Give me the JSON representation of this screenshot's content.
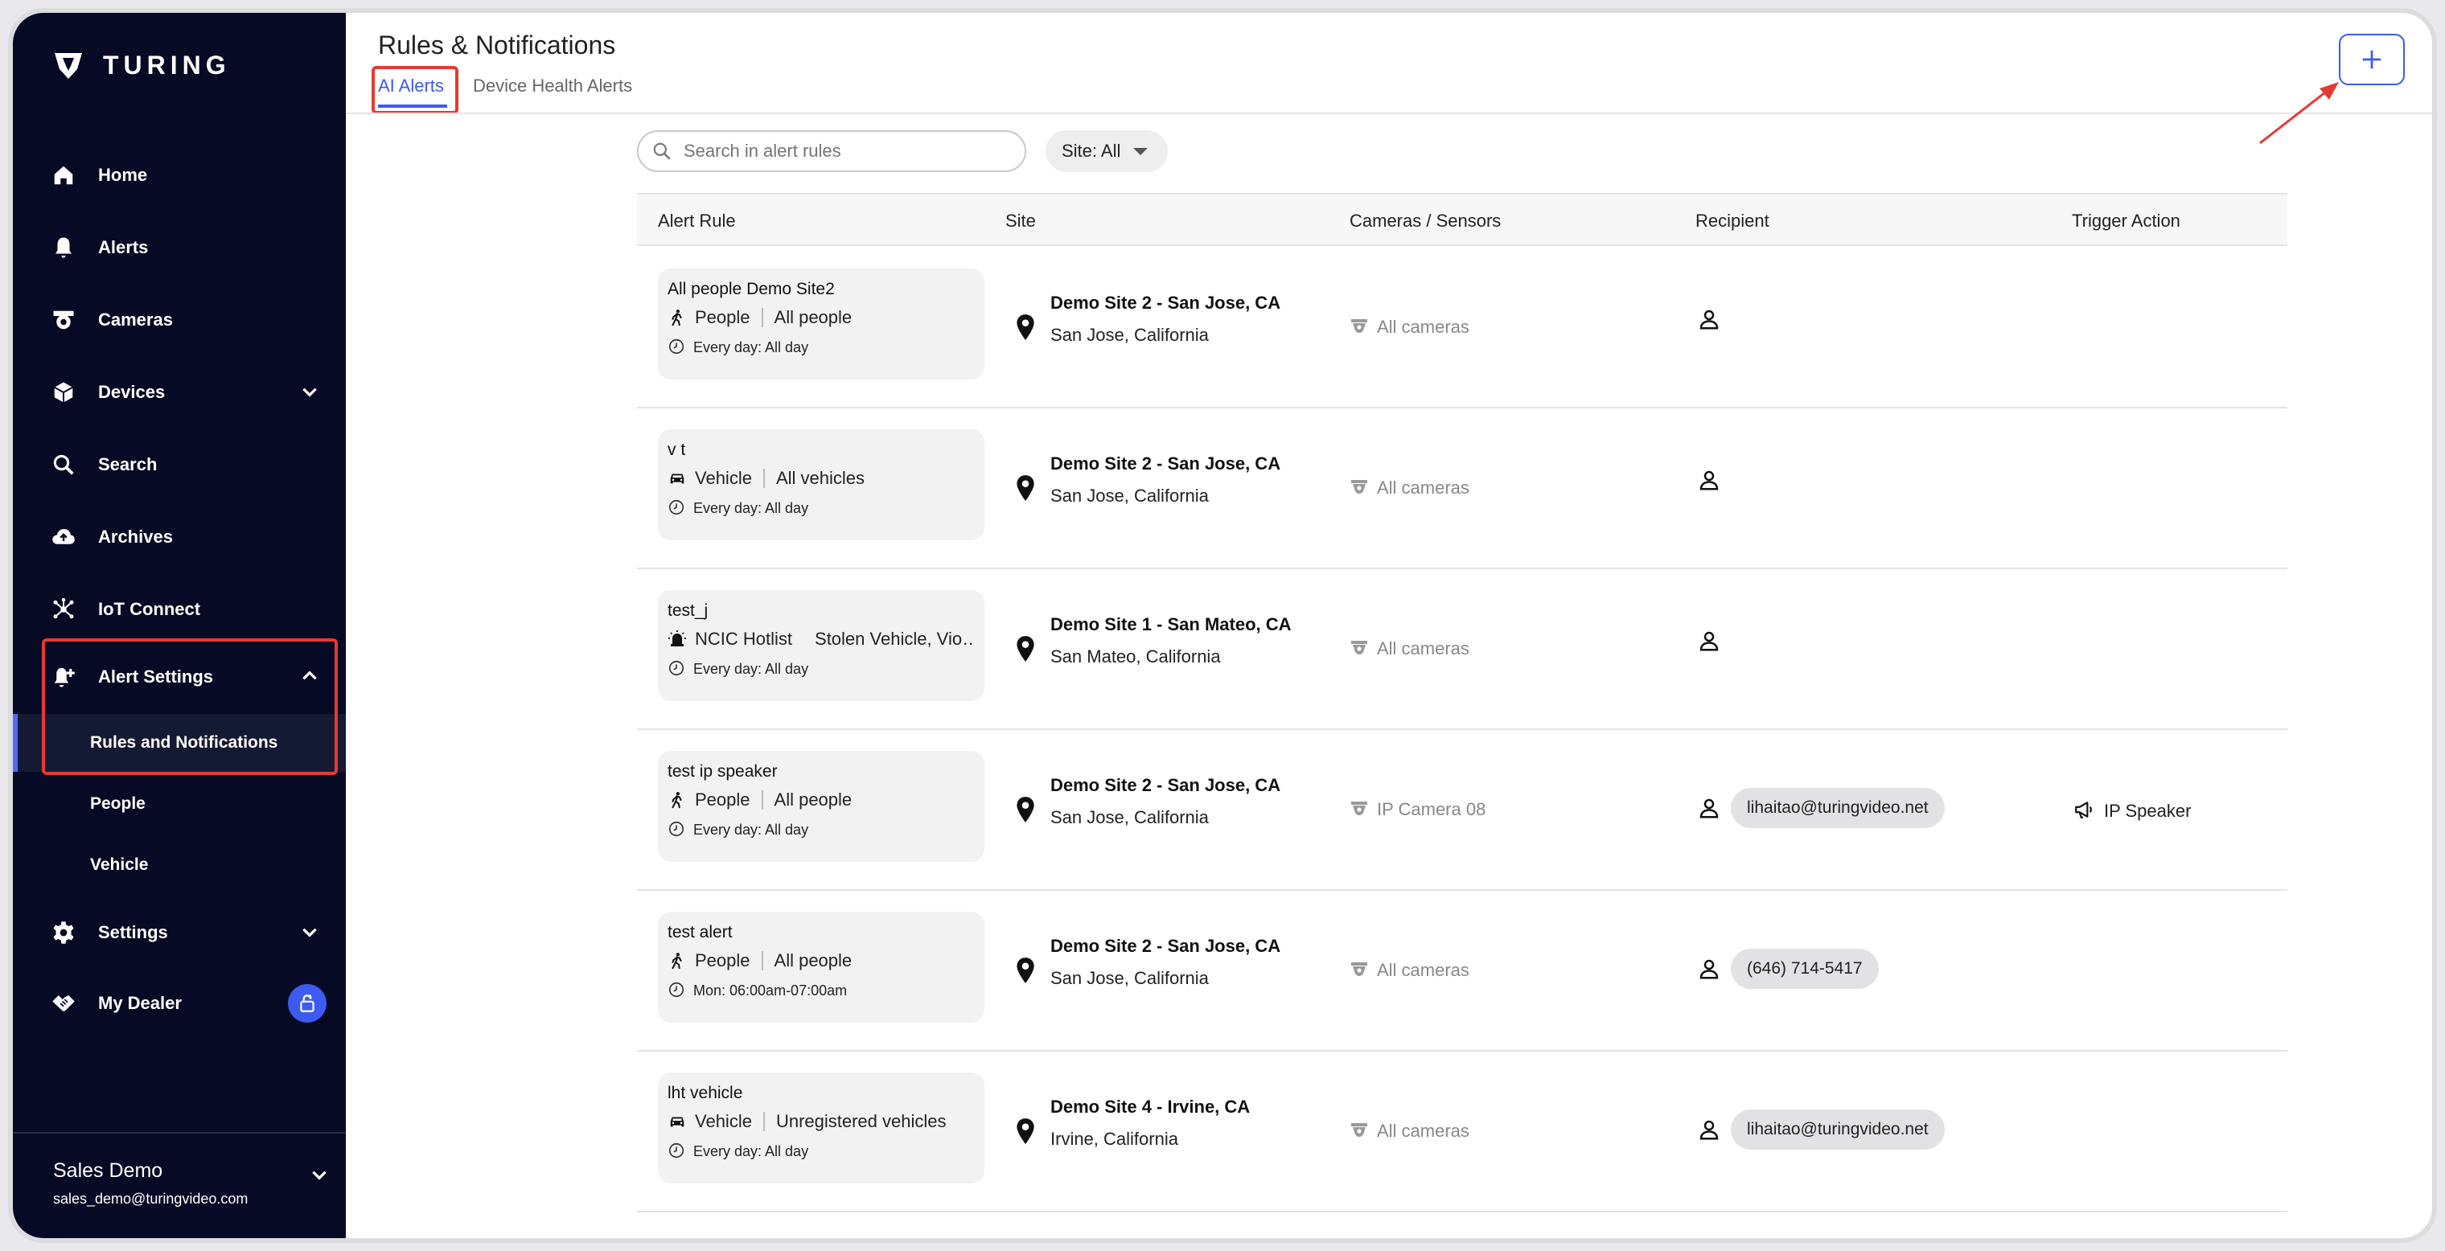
{
  "brand": {
    "name": "TURING"
  },
  "nav": {
    "home": "Home",
    "alerts": "Alerts",
    "cameras": "Cameras",
    "devices": "Devices",
    "search": "Search",
    "archives": "Archives",
    "iot_connect": "IoT Connect",
    "alert_settings": "Alert Settings",
    "rules_notifications": "Rules and Notifications",
    "people": "People",
    "vehicle": "Vehicle",
    "settings": "Settings",
    "my_dealer": "My Dealer"
  },
  "account": {
    "name": "Sales Demo",
    "email": "sales_demo@turingvideo.com"
  },
  "page": {
    "title": "Rules & Notifications",
    "tabs": [
      "AI Alerts",
      "Device Health Alerts"
    ],
    "add_label": "+"
  },
  "search": {
    "placeholder": "Search in alert rules"
  },
  "site_filter": {
    "label": "Site: All"
  },
  "table": {
    "headers": [
      "Alert Rule",
      "Site",
      "Cameras / Sensors",
      "Recipient",
      "Trigger Action"
    ],
    "rows": [
      {
        "name": "All people Demo Site2",
        "icon": "person-walking-icon",
        "type": "People",
        "target": "All people",
        "schedule": "Every day: All day",
        "site": "Demo Site 2 - San Jose, CA",
        "location": "San Jose, California",
        "cameras": "All cameras",
        "recipient": "",
        "action": ""
      },
      {
        "name": "v t",
        "icon": "car-icon",
        "type": "Vehicle",
        "target": "All vehicles",
        "schedule": "Every day: All day",
        "site": "Demo Site 2 - San Jose, CA",
        "location": "San Jose, California",
        "cameras": "All cameras",
        "recipient": "",
        "action": ""
      },
      {
        "name": "test_j",
        "icon": "alarm-icon",
        "type": "NCIC Hotlist",
        "target": "Stolen Vehicle, Vio…",
        "schedule": "Every day: All day",
        "site": "Demo Site 1 - San Mateo, CA",
        "location": "San Mateo, California",
        "cameras": "All cameras",
        "recipient": "",
        "action": ""
      },
      {
        "name": "test ip speaker",
        "icon": "person-walking-icon",
        "type": "People",
        "target": "All people",
        "schedule": "Every day: All day",
        "site": "Demo Site 2 - San Jose, CA",
        "location": "San Jose, California",
        "cameras": "IP Camera 08",
        "recipient": "lihaitao@turingvideo.net",
        "action": "IP Speaker"
      },
      {
        "name": "test alert",
        "icon": "person-walking-icon",
        "type": "People",
        "target": "All people",
        "schedule": "Mon: 06:00am-07:00am",
        "site": "Demo Site 2 - San Jose, CA",
        "location": "San Jose, California",
        "cameras": "All cameras",
        "recipient": "(646) 714-5417",
        "action": ""
      },
      {
        "name": "lht vehicle",
        "icon": "car-icon",
        "type": "Vehicle",
        "target": "Unregistered vehicles",
        "schedule": "Every day: All day",
        "site": "Demo Site 4 - Irvine, CA",
        "location": "Irvine, California",
        "cameras": "All cameras",
        "recipient": "lihaitao@turingvideo.net",
        "action": ""
      }
    ]
  },
  "colors": {
    "sidebar_bg": "#070a24",
    "accent": "#3d5af1",
    "highlight": "#e53935"
  }
}
